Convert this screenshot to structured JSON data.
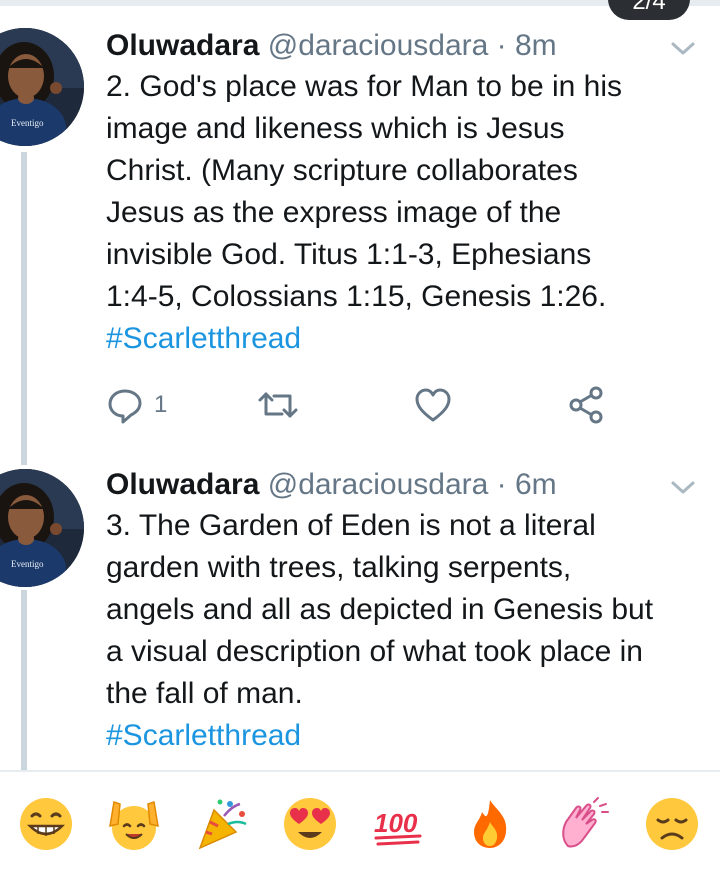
{
  "top_indicator": "2/4",
  "tweets": [
    {
      "name": "Oluwadara",
      "handle": "@daraciousdara",
      "time": "· 8m",
      "lines": [
        "2. God's place was for Man to be in his",
        "image and likeness which is Jesus",
        "Christ. (Many scripture collaborates",
        "Jesus as the express image of the",
        "invisible God. Titus 1:1-3, Ephesians",
        "1:4-5, Colossians 1:15, Genesis 1:26."
      ],
      "hashtag": "#Scarletthread",
      "reply_count": "1",
      "avatar_text": "Eventigo"
    },
    {
      "name": "Oluwadara",
      "handle": "@daraciousdara",
      "time": "· 6m",
      "lines": [
        "3. The Garden of Eden is not a literal",
        "garden with trees, talking serpents,",
        "angels and all as depicted in Genesis but",
        "a visual description of what took place in",
        "the fall of man."
      ],
      "hashtag": "#Scarletthread",
      "avatar_text": "Eventigo"
    }
  ],
  "icons": {
    "reply": "reply-icon",
    "retweet": "retweet-icon",
    "like": "like-icon",
    "share": "share-icon",
    "caret": "chevron-down-icon"
  },
  "emoji_bar": [
    {
      "name": "grinning-face-emoji",
      "char": "😁"
    },
    {
      "name": "raising-hands-emoji",
      "char": "🙌"
    },
    {
      "name": "party-popper-emoji",
      "char": "🎉"
    },
    {
      "name": "heart-eyes-emoji",
      "char": "😍"
    },
    {
      "name": "hundred-points-emoji",
      "char": "💯"
    },
    {
      "name": "fire-emoji",
      "char": "🔥"
    },
    {
      "name": "clapping-hands-emoji",
      "char": "👏"
    },
    {
      "name": "disappointed-face-emoji",
      "char": "😞"
    }
  ],
  "colors": {
    "link": "#1b95e0",
    "meta": "#657786",
    "text": "#14171a",
    "thread_line": "#ccd6dd",
    "emoji_yellow": "#ffc83d"
  }
}
